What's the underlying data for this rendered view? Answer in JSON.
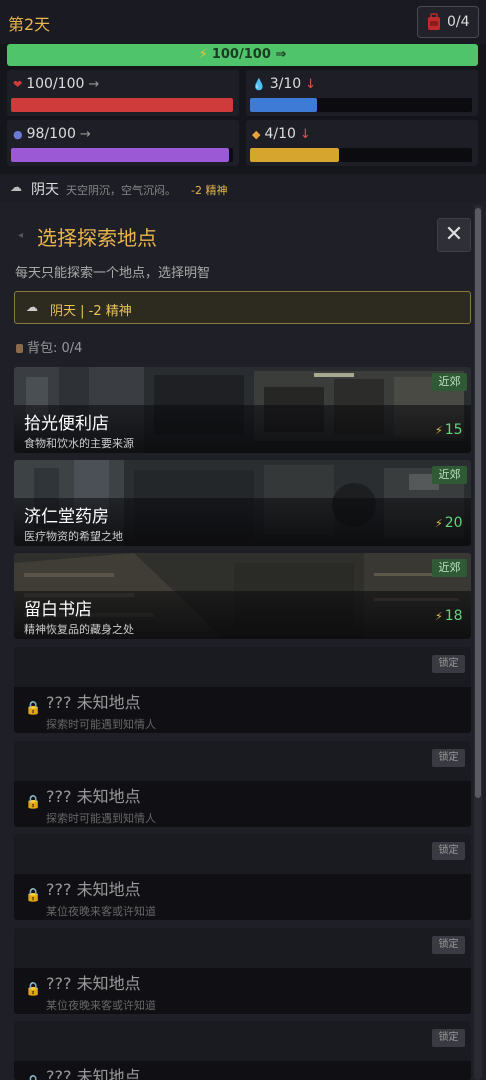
{
  "header": {
    "day": "第2天",
    "bag_count": "0/4",
    "energy": {
      "label": "100/100 ⇒",
      "value": 1.0
    }
  },
  "stats": [
    {
      "id": "health",
      "label": "100/100",
      "arrow": "→",
      "arrow_color": "#999999",
      "icon": "heart-icon",
      "color": "#cf3b3b",
      "fill": 1.0
    },
    {
      "id": "water",
      "label": "3/10",
      "arrow": "↓",
      "arrow_color": "#e05050",
      "icon": "water-drop-icon",
      "color": "#3d7bd6",
      "fill": 0.3
    },
    {
      "id": "mind",
      "label": "98/100",
      "arrow": "→",
      "arrow_color": "#999999",
      "icon": "brain-orb-icon",
      "color": "#9b59d6",
      "fill": 0.98
    },
    {
      "id": "food",
      "label": "4/10",
      "arrow": "↓",
      "arrow_color": "#e05050",
      "icon": "bread-icon",
      "color": "#d6a52d",
      "fill": 0.4
    }
  ],
  "weather": {
    "name": "阴天",
    "desc": "天空阴沉，空气沉闷。",
    "effect": "-2 精神"
  },
  "panel": {
    "title": "选择探索地点",
    "close": "✕",
    "hint": "每天只能探索一个地点，选择明智",
    "weather_notice": "阴天 | -2 精神",
    "bag_label": "背包: 0/4"
  },
  "locations": [
    {
      "name": "拾光便利店",
      "sub": "食物和饮水的主要来源",
      "tag": "近郊",
      "cost": "15"
    },
    {
      "name": "济仁堂药房",
      "sub": "医疗物资的希望之地",
      "tag": "近郊",
      "cost": "20"
    },
    {
      "name": "留白书店",
      "sub": "精神恢复品的藏身之处",
      "tag": "近郊",
      "cost": "18"
    }
  ],
  "locked": [
    {
      "name": "??? 未知地点",
      "sub": "探索时可能遇到知情人",
      "badge": "锁定"
    },
    {
      "name": "??? 未知地点",
      "sub": "探索时可能遇到知情人",
      "badge": "锁定"
    },
    {
      "name": "??? 未知地点",
      "sub": "某位夜晚来客或许知道",
      "badge": "锁定"
    },
    {
      "name": "??? 未知地点",
      "sub": "某位夜晚来客或许知道",
      "badge": "锁定"
    },
    {
      "name": "??? 未知地点",
      "sub": "",
      "badge": "锁定"
    }
  ]
}
